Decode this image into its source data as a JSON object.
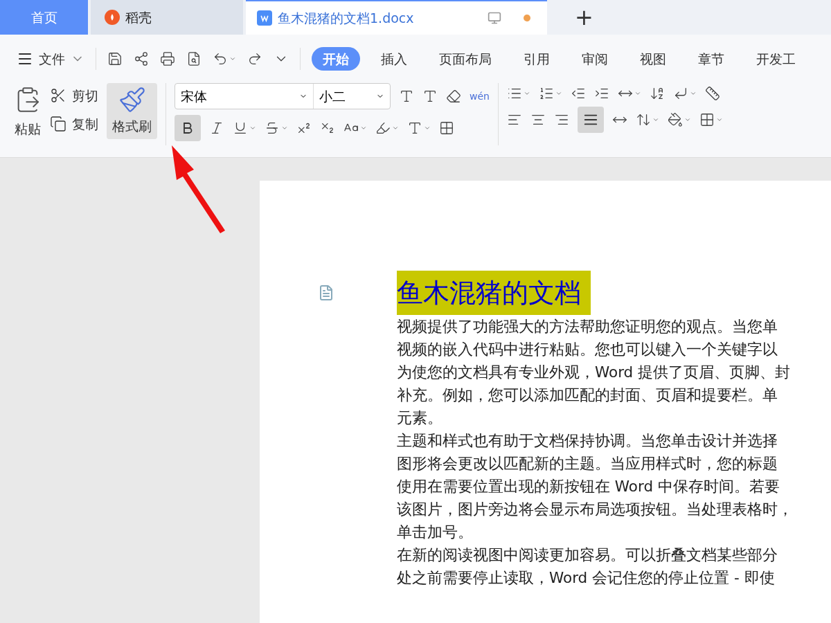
{
  "tabs": [
    {
      "kind": "home",
      "label": "首页",
      "selected": false
    },
    {
      "kind": "store",
      "label": "稻壳",
      "selected": false
    },
    {
      "kind": "doc",
      "label": "鱼木混猪的文档1.docx",
      "selected": true,
      "unsaved": true
    }
  ],
  "new_tab": "+",
  "file_menu": "文件",
  "ribbon_tabs": [
    {
      "label": "开始",
      "selected": true
    },
    {
      "label": "插入",
      "selected": false
    },
    {
      "label": "页面布局",
      "selected": false
    },
    {
      "label": "引用",
      "selected": false
    },
    {
      "label": "审阅",
      "selected": false
    },
    {
      "label": "视图",
      "selected": false
    },
    {
      "label": "章节",
      "selected": false
    },
    {
      "label": "开发工",
      "selected": false
    }
  ],
  "clipboard": {
    "paste": "粘贴",
    "cut": "剪切",
    "copy": "复制",
    "format_painter": {
      "label": "格式刷",
      "selected": true
    }
  },
  "font": {
    "name": "宋体",
    "size": "小二",
    "bold": true,
    "phonetic": "wén"
  },
  "alignment": {
    "justify": true
  },
  "document": {
    "title": "鱼木混猪的文档",
    "title_highlighted": true,
    "lines": [
      "视频提供了功能强大的方法帮助您证明您的观点。当您单",
      "视频的嵌入代码中进行粘贴。您也可以键入一个关键字以",
      "为使您的文档具有专业外观，Word 提供了页眉、页脚、封",
      "补充。例如，您可以添加匹配的封面、页眉和提要栏。单",
      "元素。",
      "主题和样式也有助于文档保持协调。当您单击设计并选择",
      "图形将会更改以匹配新的主题。当应用样式时，您的标题",
      "使用在需要位置出现的新按钮在 Word 中保存时间。若要",
      "该图片，图片旁边将会显示布局选项按钮。当处理表格时，",
      "单击加号。",
      "在新的阅读视图中阅读更加容易。可以折叠文档某些部分",
      "处之前需要停止读取，Word 会记住您的停止位置 - 即使"
    ]
  }
}
